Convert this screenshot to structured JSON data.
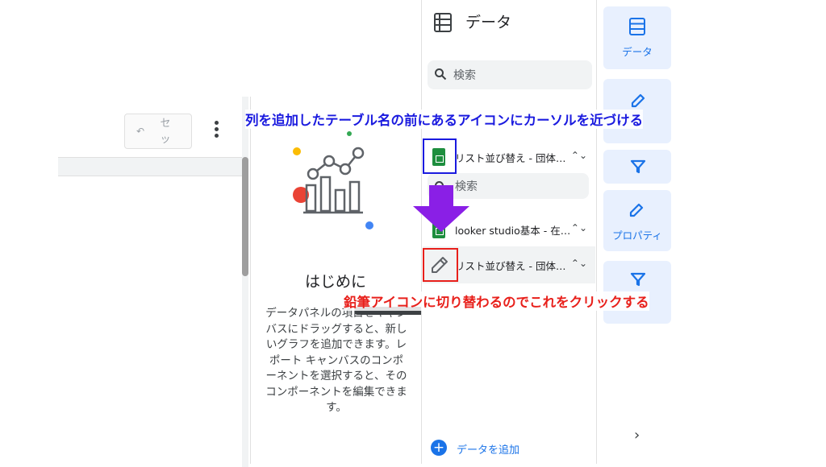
{
  "toolbar": {
    "reset_label": "セッ",
    "undo_glyph": "↶"
  },
  "getting_started": {
    "title": "はじめに",
    "body": "データパネルの項目をキャンバスにドラッグすると、新しいグラフを追加できます。レポート キャンバスのコンポーネントを選択すると、そのコンポーネントを編集できます。"
  },
  "data_panel": {
    "title": "データ",
    "search_placeholder": "検索",
    "search_placeholder_2": "検索",
    "data_sources": [
      {
        "name": "リスト並び替え - 団体…",
        "icon": "google-sheets-icon"
      },
      {
        "name": "looker studio基本 - 在…",
        "icon": "google-sheets-icon"
      },
      {
        "name": "リスト並び替え - 団体…",
        "icon": "pencil-icon"
      }
    ],
    "add_data_label": "データを追加"
  },
  "rail": {
    "data_label": "データ",
    "properties_label": "プロパティ"
  },
  "annotations": {
    "top": "列を追加したテーブル名の前にあるアイコンにカーソルを近づける",
    "bottom": "鉛筆アイコンに切り替わるのでこれをクリックする"
  },
  "colors": {
    "accent": "#1a73e8",
    "rail_bg": "#e8f0fe",
    "annotation_blue": "#1a1adf",
    "annotation_red": "#e8201b",
    "arrow_purple": "#8a1fe6",
    "sheets_green": "#1e8e3e"
  }
}
